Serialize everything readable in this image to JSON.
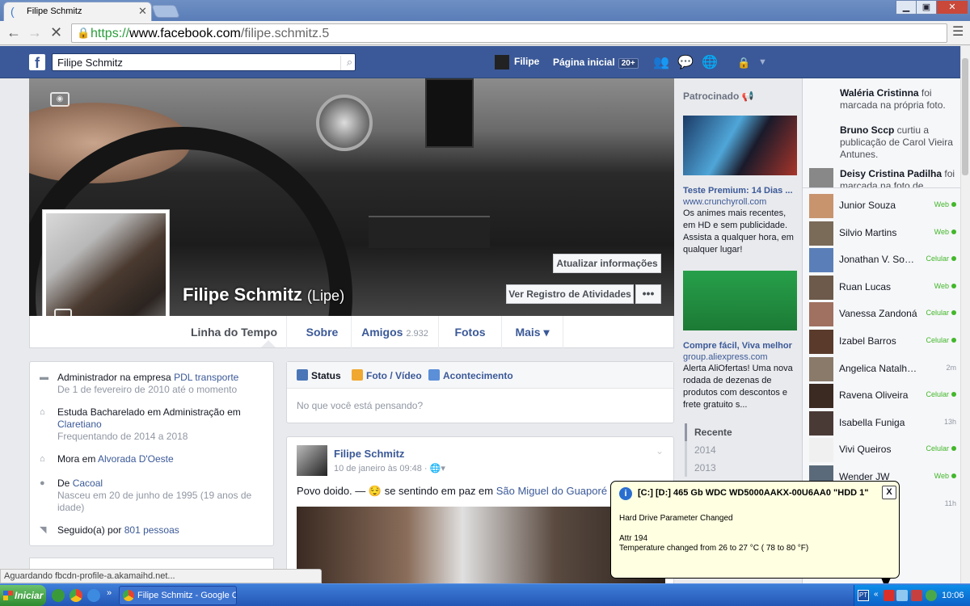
{
  "browser": {
    "tab_title": "Filipe Schmitz",
    "url_scheme": "https://",
    "url_host": "www.facebook.com",
    "url_path": "/filipe.schmitz.5",
    "status_text": "Aguardando fbcdn-profile-a.akamaihd.net..."
  },
  "fbbar": {
    "logo": "f",
    "search_value": "Filipe Schmitz",
    "user": "Filipe",
    "home": "Página inicial",
    "home_badge": "20+"
  },
  "profile": {
    "name": "Filipe Schmitz",
    "alt_name": "(Lipe)",
    "update_button": "Atualizar informações",
    "activity_button": "Ver Registro de Atividades",
    "more_button": "•••"
  },
  "timeline_nav": [
    {
      "label": "Linha do Tempo",
      "count": ""
    },
    {
      "label": "Sobre",
      "count": ""
    },
    {
      "label": "Amigos",
      "count": "2.932"
    },
    {
      "label": "Fotos",
      "count": ""
    },
    {
      "label": "Mais ▾",
      "count": ""
    }
  ],
  "about": {
    "work": {
      "prefix": "Administrador na empresa ",
      "link": "PDL transporte",
      "sub": "De 1 de fevereiro de 2010 até o momento"
    },
    "edu": {
      "prefix": "Estuda Bacharelado em Administração em ",
      "link": "Claretiano",
      "sub": "Frequentando de 2014 a 2018"
    },
    "lives": {
      "prefix": "Mora em ",
      "link": "Alvorada D'Oeste"
    },
    "from": {
      "prefix": "De ",
      "link": "Cacoal",
      "sub": "Nasceu em 20 de junho de 1995 (19 anos de idade)"
    },
    "followers": {
      "prefix": "Seguido(a) por ",
      "link": "801 pessoas"
    }
  },
  "composer": {
    "tabs": [
      "Status",
      "Foto / Vídeo",
      "Acontecimento"
    ],
    "placeholder": "No que você está pensando?"
  },
  "post": {
    "author": "Filipe Schmitz",
    "time": "10 de janeiro às 09:48 · ",
    "text_prefix": "Povo doido. — ",
    "feeling": "se sentindo em paz em ",
    "place": "São Miguel do Guaporé"
  },
  "ads": {
    "header": "Patrocinado",
    "ad1": {
      "title": "Teste Premium: 14 Dias ...",
      "url": "www.crunchyroll.com",
      "body": "Os animes mais recentes, em HD e sem publicidade. Assista a qualquer hora, em qualquer lugar!"
    },
    "ad2": {
      "title": "Compre fácil, Viva melhor",
      "url": "group.aliexpress.com",
      "body": "Alerta AliOfertas! Uma nova rodada de dezenas de produtos com descontos e frete gratuito s..."
    },
    "years": [
      "Recente",
      "2014",
      "2013"
    ]
  },
  "ticker": [
    {
      "name": "Waléria Cristinna",
      "text": " foi marcada na própria foto."
    },
    {
      "name": "Bruno Sccp",
      "text": " curtiu a publicação de Carol Vieira Antunes."
    },
    {
      "name": "Deisy Cristina Padilha",
      "text": " foi marcada na foto de"
    }
  ],
  "chat": [
    {
      "name": "Junior Souza",
      "status": "Web",
      "online": true
    },
    {
      "name": "Silvio Martins",
      "status": "Web",
      "online": true
    },
    {
      "name": "Jonathan V. Souza",
      "status": "Celular",
      "online": true
    },
    {
      "name": "Ruan Lucas",
      "status": "Web",
      "online": true
    },
    {
      "name": "Vanessa Zandoná",
      "status": "Celular",
      "online": true
    },
    {
      "name": "Izabel Barros",
      "status": "Celular",
      "online": true
    },
    {
      "name": "Angelica Natalha ...",
      "status": "2m",
      "online": false
    },
    {
      "name": "Ravena Oliveira",
      "status": "Celular",
      "online": true
    },
    {
      "name": "Isabella Funiga",
      "status": "13h",
      "online": false
    },
    {
      "name": "Vivi Queiros",
      "status": "Celular",
      "online": true
    },
    {
      "name": "Wender JW",
      "status": "Web",
      "online": true
    },
    {
      "name": "",
      "status": "11h",
      "online": false
    }
  ],
  "balloon": {
    "title": "[C:] [D:]  465 Gb  WDC WD5000AAKX-00U6AA0  \"HDD 1\"",
    "line1": "Hard Drive Parameter Changed",
    "line2": "Attr 194",
    "line3": "Temperature changed from 26 to 27 °C ( 78 to 80 °F)",
    "close": "X"
  },
  "taskbar": {
    "start": "Iniciar",
    "task": "Filipe Schmitz - Google C...",
    "lang": "PT",
    "clock": "10:06"
  },
  "colors": {
    "fb_blue": "#3b5998",
    "online": "#42b72a"
  }
}
